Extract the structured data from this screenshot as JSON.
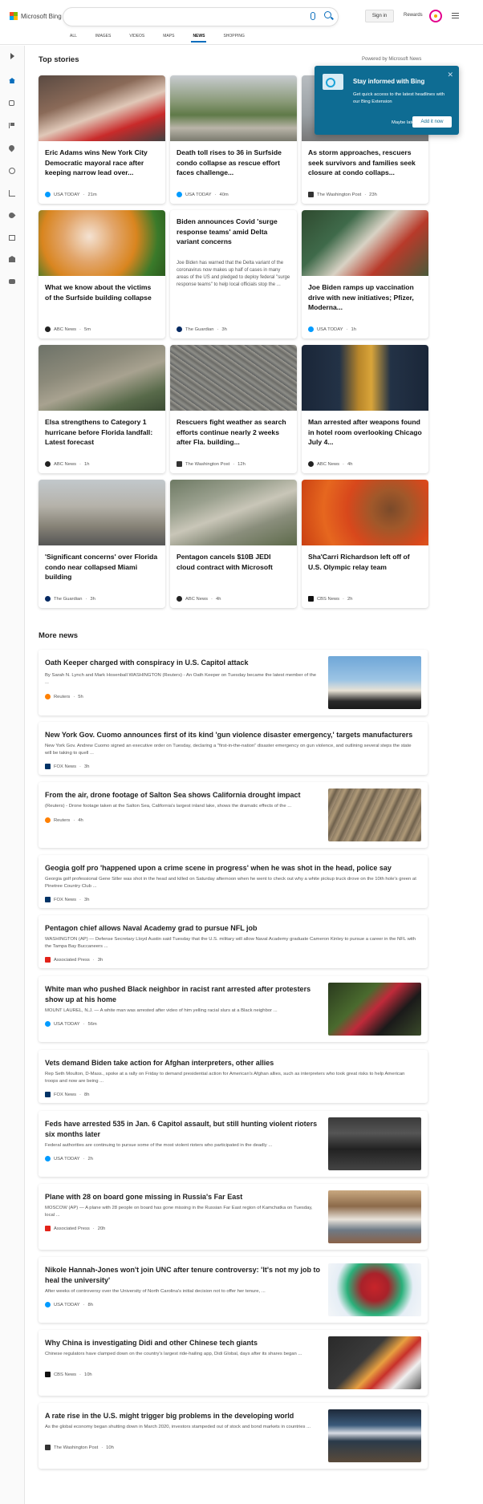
{
  "header": {
    "logo_text": "Microsoft Bing",
    "signin": "Sign in",
    "rewards": "Rewards",
    "scopes": [
      "ALL",
      "IMAGES",
      "VIDEOS",
      "MAPS",
      "NEWS",
      "SHOPPING"
    ],
    "active_scope": "NEWS"
  },
  "top_stories": {
    "title": "Top stories",
    "powered_by": "Powered by Microsoft News",
    "cards": [
      {
        "title": "Eric Adams wins New York City Democratic mayoral race after keeping narrow lead over...",
        "source": "USA TODAY",
        "time": "21m",
        "src_color": "#009bff"
      },
      {
        "title": "Death toll rises to 36 in Surfside condo collapse as rescue effort faces challenge...",
        "source": "USA TODAY",
        "time": "40m",
        "src_color": "#009bff"
      },
      {
        "title": "As storm approaches, rescuers seek survivors and families seek closure at condo collaps...",
        "source": "The Washington Post",
        "time": "23h",
        "src_color": "#333333"
      },
      {
        "title": "What we know about the victims of the Surfside building collapse",
        "source": "ABC News",
        "time": "5m",
        "src_color": "#222222"
      },
      {
        "title": "Biden announces Covid 'surge response teams' amid Delta variant concerns",
        "desc": "Joe Biden has warned that the Delta variant of the coronavirus now makes up half of cases in many areas of the US and pledged to deploy federal \"surge response teams\" to help local officials stop the ...",
        "source": "The Guardian",
        "time": "3h",
        "src_color": "#052962"
      },
      {
        "title": "Joe Biden ramps up vaccination drive with new initiatives; Pfizer, Moderna...",
        "source": "USA TODAY",
        "time": "1h",
        "src_color": "#009bff"
      },
      {
        "title": "Elsa strengthens to Category 1 hurricane before Florida landfall: Latest forecast",
        "source": "ABC News",
        "time": "1h",
        "src_color": "#222222"
      },
      {
        "title": "Rescuers fight weather as search efforts continue nearly 2 weeks after Fla. building...",
        "source": "The Washington Post",
        "time": "12h",
        "src_color": "#333333"
      },
      {
        "title": "Man arrested after weapons found in hotel room overlooking Chicago July 4...",
        "source": "ABC News",
        "time": "4h",
        "src_color": "#222222"
      },
      {
        "title": "'Significant concerns' over Florida condo near collapsed Miami building",
        "source": "The Guardian",
        "time": "3h",
        "src_color": "#052962"
      },
      {
        "title": "Pentagon cancels $10B JEDI cloud contract with Microsoft",
        "source": "ABC News",
        "time": "4h",
        "src_color": "#222222"
      },
      {
        "title": "Sha'Carri Richardson left off of U.S. Olympic relay team",
        "source": "CBS News",
        "time": "2h",
        "src_color": "#111111"
      }
    ]
  },
  "popup": {
    "title": "Stay informed with Bing",
    "text": "Get quick access to the latest headlines with our Bing Extension",
    "later": "Maybe later",
    "add": "Add it now"
  },
  "more_news": {
    "title": "More news",
    "items": [
      {
        "title": "Oath Keeper charged with conspiracy in U.S. Capitol attack",
        "desc": "By Sarah N. Lynch and Mark Hosenball WASHINGTON (Reuters) - An Oath Keeper on Tuesday became the latest member of the ...",
        "source": "Reuters",
        "time": "5h",
        "src_color": "#ff8000"
      },
      {
        "title": "New York Gov. Cuomo announces first of its kind 'gun violence disaster emergency,' targets manufacturers",
        "desc": "New York Gov. Andrew Cuomo signed an executive order on Tuesday, declaring a \"first-in-the-nation\" disaster emergency on gun violence, and outlining several steps the state will be taking to quell ...",
        "source": "FOX News",
        "time": "3h",
        "src_color": "#003366"
      },
      {
        "title": "From the air, drone footage of Salton Sea shows California drought impact",
        "desc": "(Reuters) - Drone footage taken at the Salton Sea, California's largest inland lake, shows the dramatic effects of the ...",
        "source": "Reuters",
        "time": "4h",
        "src_color": "#ff8000"
      },
      {
        "title": "Geogia golf pro 'happened upon a crime scene in progress' when he was shot in the head, police say",
        "desc": "Georgia golf professional Gene Siller was shot in the head and killed on Saturday afternoon when he went to check out why a white pickup truck drove on the 10th hole's green at Pinetree Country Club ...",
        "source": "FOX News",
        "time": "3h",
        "src_color": "#003366"
      },
      {
        "title": "Pentagon chief allows Naval Academy grad to pursue NFL job",
        "desc": "WASHINGTON (AP) — Defense Secretary Lloyd Austin said Tuesday that the U.S. military will allow Naval Academy graduate Cameron Kinley to pursue a career in the NFL with the Tampa Bay Buccaneers ...",
        "source": "Associated Press",
        "time": "3h",
        "src_color": "#e2231a"
      },
      {
        "title": "White man who pushed Black neighbor in racist rant arrested after protesters show up at his home",
        "desc": "MOUNT LAUREL, N.J. — A white man was arrested after video of him yelling racial slurs at a Black neighbor ...",
        "source": "USA TODAY",
        "time": "56m",
        "src_color": "#009bff"
      },
      {
        "title": "Vets demand Biden take action for Afghan interpreters, other allies",
        "desc": "Rep Seth Moulton, D-Mass., spoke at a rally on Friday to demand presidential action for American's Afghan allies, such as interpreters who took great risks to help American troops and now are being ...",
        "source": "FOX News",
        "time": "8h",
        "src_color": "#003366"
      },
      {
        "title": "Feds have arrested 535 in Jan. 6 Capitol assault, but still hunting violent rioters six months later",
        "desc": "Federal authorities are continuing to pursue some of the most violent rioters who participated in the deadly ...",
        "source": "USA TODAY",
        "time": "2h",
        "src_color": "#009bff"
      },
      {
        "title": "Plane with 28 on board gone missing in Russia's Far East",
        "desc": "MOSCOW (AP) — A plane with 28 people on board has gone missing in the Russian Far East region of Kamchatka on Tuesday, local ...",
        "source": "Associated Press",
        "time": "20h",
        "src_color": "#e2231a"
      },
      {
        "title": "Nikole Hannah-Jones won't join UNC after tenure controversy: 'It's not my job to heal the university'",
        "desc": "After weeks of controversy over the University of North Carolina's initial decision not to offer her tenure, ...",
        "source": "USA TODAY",
        "time": "8h",
        "src_color": "#009bff"
      },
      {
        "title": "Why China is investigating Didi and other Chinese tech giants",
        "desc": "Chinese regulators have clamped down on the country's largest ride-hailing app, Didi Global, days after its shares began ...",
        "source": "CBS News",
        "time": "10h",
        "src_color": "#111111"
      },
      {
        "title": "A rate rise in the U.S. might trigger big problems in the developing world",
        "desc": "As the global economy began shutting down in March 2020, investors stampeded out of stock and bond markets in countries ...",
        "source": "The Washington Post",
        "time": "10h",
        "src_color": "#333333"
      }
    ]
  }
}
